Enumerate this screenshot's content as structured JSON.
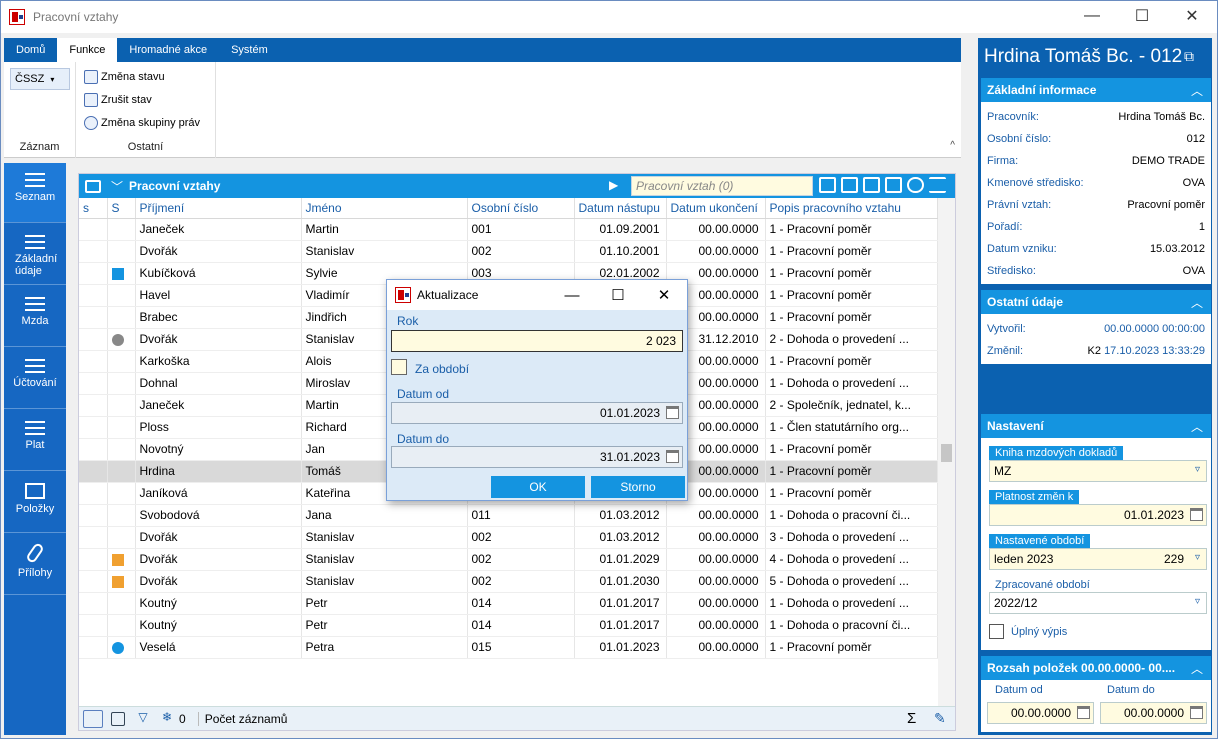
{
  "window": {
    "title": "Pracovní vztahy"
  },
  "ribbon": {
    "tabs": [
      "Domů",
      "Funkce",
      "Hromadné akce",
      "Systém"
    ],
    "cssz": "ČSSZ",
    "buttons": [
      "Změna stavu",
      "Zrušit stav",
      "Změna skupiny práv"
    ],
    "groups": [
      "Záznam",
      "Ostatní"
    ]
  },
  "sidebar": [
    "Seznam",
    "Základní údaje",
    "Mzda",
    "Účtování",
    "Plat",
    "Položky",
    "Přílohy"
  ],
  "grid": {
    "title": "Pracovní vztahy",
    "search_placeholder": "Pracovní vztah (0)",
    "columns": [
      "s",
      "S",
      "Příjmení",
      "Jméno",
      "Osobní číslo",
      "Datum nástupu",
      "Datum ukončení",
      "Popis pracovního vztahu"
    ],
    "rows": [
      [
        "",
        "",
        "Janeček",
        "Martin",
        "001",
        "01.09.2001",
        "00.00.0000",
        "1 - Pracovní poměr"
      ],
      [
        "",
        "",
        "Dvořák",
        "Stanislav",
        "002",
        "01.10.2001",
        "00.00.0000",
        "1 - Pracovní poměr"
      ],
      [
        "",
        "play",
        "Kubíčková",
        "Sylvie",
        "003",
        "02.01.2002",
        "00.00.0000",
        "1 - Pracovní poměr"
      ],
      [
        "",
        "",
        "Havel",
        "Vladimír",
        "",
        "",
        "00.00.0000",
        "1 - Pracovní poměr"
      ],
      [
        "",
        "",
        "Brabec",
        "Jindřich",
        "",
        "",
        "00.00.0000",
        "1 - Pracovní poměr"
      ],
      [
        "",
        "clock",
        "Dvořák",
        "Stanislav",
        "",
        "",
        "31.12.2010",
        "2 - Dohoda o provedení ..."
      ],
      [
        "",
        "",
        "Karkoška",
        "Alois",
        "",
        "",
        "00.00.0000",
        "1 - Pracovní poměr"
      ],
      [
        "",
        "",
        "Dohnal",
        "Miroslav",
        "",
        "",
        "00.00.0000",
        "1 - Dohoda o provedení ..."
      ],
      [
        "",
        "",
        "Janeček",
        "Martin",
        "",
        "",
        "00.00.0000",
        "2 - Společník, jednatel, k..."
      ],
      [
        "",
        "",
        "Ploss",
        "Richard",
        "",
        "",
        "00.00.0000",
        "1 - Člen statutárního org..."
      ],
      [
        "",
        "",
        "Novotný",
        "Jan",
        "",
        "",
        "00.00.0000",
        "1 - Pracovní poměr"
      ],
      [
        "",
        "",
        "Hrdina",
        "Tomáš",
        "",
        "",
        "00.00.0000",
        "1 - Pracovní poměr"
      ],
      [
        "",
        "",
        "Janíková",
        "Kateřina",
        "",
        "",
        "00.00.0000",
        "1 - Pracovní poměr"
      ],
      [
        "",
        "",
        "Svobodová",
        "Jana",
        "011",
        "01.03.2012",
        "00.00.0000",
        "1 - Dohoda o pracovní či..."
      ],
      [
        "",
        "",
        "Dvořák",
        "Stanislav",
        "002",
        "01.03.2012",
        "00.00.0000",
        "3 - Dohoda o provedení ..."
      ],
      [
        "",
        "down",
        "Dvořák",
        "Stanislav",
        "002",
        "01.01.2029",
        "00.00.0000",
        "4 - Dohoda o provedení ..."
      ],
      [
        "",
        "down",
        "Dvořák",
        "Stanislav",
        "002",
        "01.01.2030",
        "00.00.0000",
        "5 - Dohoda o provedení ..."
      ],
      [
        "",
        "",
        "Koutný",
        "Petr",
        "014",
        "01.01.2017",
        "00.00.0000",
        "1 - Dohoda o provedení ..."
      ],
      [
        "",
        "",
        "Koutný",
        "Petr",
        "014",
        "01.01.2017",
        "00.00.0000",
        "1 - Dohoda o pracovní či..."
      ],
      [
        "",
        "clockblue",
        "Veselá",
        "Petra",
        "015",
        "01.01.2023",
        "00.00.0000",
        "1 - Pracovní poměr"
      ]
    ],
    "footer_count": "0",
    "footer_label": "Počet záznamů"
  },
  "dialog": {
    "title": "Aktualizace",
    "rok_label": "Rok",
    "rok_value": "2 023",
    "za_obdobi": "Za období",
    "od_label": "Datum od",
    "od_value": "01.01.2023",
    "do_label": "Datum do",
    "do_value": "31.01.2023",
    "ok": "OK",
    "storno": "Storno"
  },
  "detail": {
    "title": "Hrdina Tomáš Bc. - 012",
    "zakladni": {
      "header": "Základní informace",
      "items": [
        [
          "Pracovník:",
          "Hrdina Tomáš Bc."
        ],
        [
          "Osobní číslo:",
          "012"
        ],
        [
          "Firma:",
          "DEMO TRADE"
        ],
        [
          "Kmenové středisko:",
          "OVA"
        ],
        [
          "Právní vztah:",
          "Pracovní poměr"
        ],
        [
          "Pořadí:",
          "1"
        ],
        [
          "Datum vzniku:",
          "15.03.2012"
        ],
        [
          "Středisko:",
          "OVA"
        ]
      ]
    },
    "ostatni": {
      "header": "Ostatní údaje",
      "vytvoril_label": "Vytvořil:",
      "vytvoril": "00.00.0000 00:00:00",
      "zmenil_label": "Změnil:",
      "zmenil_user": "K2",
      "zmenil": "17.10.2023 13:33:29"
    },
    "nastaveni": {
      "header": "Nastavení",
      "kniha_label": "Kniha mzdových dokladů",
      "kniha": "MZ",
      "platnost_label": "Platnost změn k",
      "platnost": "01.01.2023",
      "obdobi_label": "Nastavené období",
      "obdobi": "leden 2023",
      "obdobi_num": "229",
      "zpracovane_label": "Zpracované období",
      "zpracovane": "2022/12",
      "uplny": "Úplný výpis"
    },
    "rozsah": {
      "header": "Rozsah položek 00.00.0000- 00....",
      "od_label": "Datum od",
      "od": "00.00.0000",
      "do_label": "Datum do",
      "do": "00.00.0000"
    }
  }
}
